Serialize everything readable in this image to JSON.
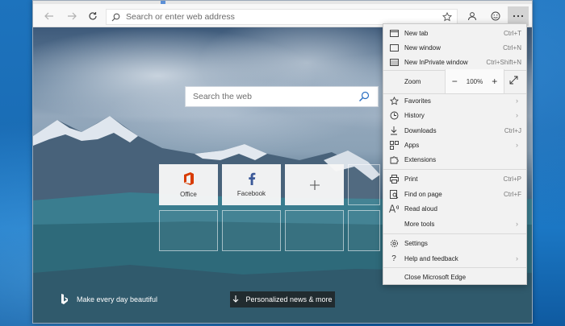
{
  "toolbar": {
    "address_placeholder": "Search or enter web address"
  },
  "newtab": {
    "search_placeholder": "Search the web",
    "tiles": [
      {
        "label": "Office",
        "icon": "office-icon",
        "color": "#d83b01"
      },
      {
        "label": "Facebook",
        "icon": "facebook-icon",
        "color": "#3b5998"
      },
      {
        "label": "",
        "icon": "plus-icon"
      }
    ],
    "bing_text": "Make every day beautiful",
    "news_button": "Personalized news & more"
  },
  "menu": {
    "new_tab": {
      "label": "New tab",
      "shortcut": "Ctrl+T"
    },
    "new_window": {
      "label": "New window",
      "shortcut": "Ctrl+N"
    },
    "new_inprivate": {
      "label": "New InPrivate window",
      "shortcut": "Ctrl+Shift+N"
    },
    "zoom": {
      "label": "Zoom",
      "value": "100%",
      "minus": "−",
      "plus": "+"
    },
    "favorites": {
      "label": "Favorites"
    },
    "history": {
      "label": "History"
    },
    "downloads": {
      "label": "Downloads",
      "shortcut": "Ctrl+J"
    },
    "apps": {
      "label": "Apps"
    },
    "extensions": {
      "label": "Extensions"
    },
    "print": {
      "label": "Print",
      "shortcut": "Ctrl+P"
    },
    "find": {
      "label": "Find on page",
      "shortcut": "Ctrl+F"
    },
    "read_aloud": {
      "label": "Read aloud"
    },
    "more_tools": {
      "label": "More tools"
    },
    "settings": {
      "label": "Settings"
    },
    "help": {
      "label": "Help and feedback"
    },
    "close": {
      "label": "Close Microsoft Edge"
    }
  },
  "colors": {
    "accent": "#1a6db6",
    "office": "#d83b01",
    "facebook": "#3b5998"
  }
}
